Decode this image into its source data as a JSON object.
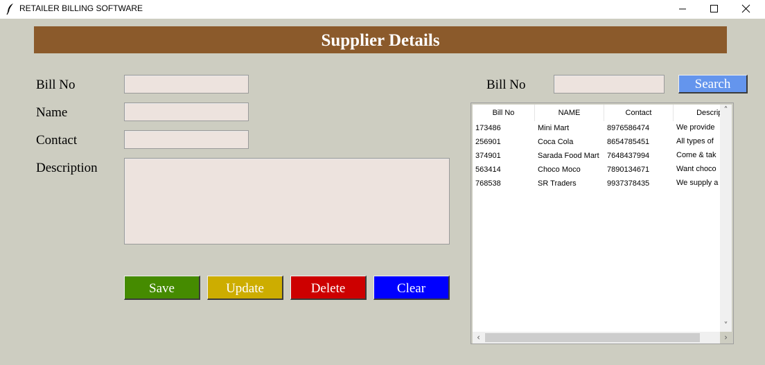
{
  "window": {
    "title": "RETAILER BILLING SOFTWARE",
    "minimize": "–",
    "maximize": "☐",
    "close": "✕"
  },
  "header": {
    "title": "Supplier Details"
  },
  "form": {
    "bill_no_label": "Bill No",
    "bill_no_value": "",
    "name_label": "Name",
    "name_value": "",
    "contact_label": "Contact",
    "contact_value": "",
    "description_label": "Description",
    "description_value": ""
  },
  "buttons": {
    "save": "Save",
    "update": "Update",
    "delete": "Delete",
    "clear": "Clear"
  },
  "search": {
    "label": "Bill No",
    "value": "",
    "button": "Search"
  },
  "table": {
    "columns": [
      "Bill No",
      "NAME",
      "Contact",
      "Descripti"
    ],
    "rows": [
      [
        "173486",
        "Mini Mart",
        "8976586474",
        "We provide"
      ],
      [
        "256901",
        "Coca Cola",
        "8654785451",
        "All types of"
      ],
      [
        "374901",
        "Sarada Food Mart",
        "7648437994",
        "Come & tak"
      ],
      [
        "563414",
        "Choco Moco",
        "7890134671",
        "Want choco"
      ],
      [
        "768538",
        "SR Traders",
        "9937378435",
        "We supply a"
      ]
    ]
  },
  "scroll": {
    "up": "˄",
    "down": "˅",
    "left": "‹",
    "right": "›"
  },
  "colors": {
    "background": "#cdcdc1",
    "header": "#8b5a2b",
    "save": "#458b00",
    "update": "#cdad00",
    "delete": "#cd0000",
    "clear": "#0000ff",
    "search": "#6495ed",
    "field": "#ede3de"
  }
}
